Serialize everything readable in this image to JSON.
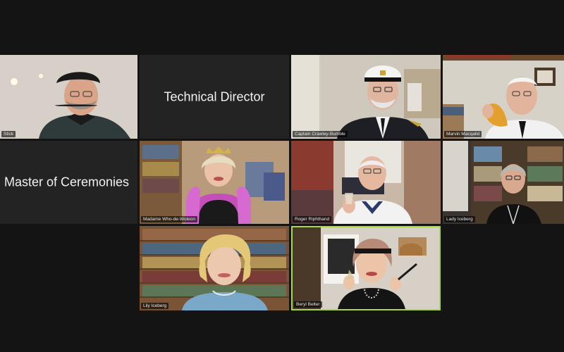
{
  "meeting": {
    "tiles": [
      {
        "name": "Stick"
      },
      {
        "title": "Technical Director"
      },
      {
        "name": "Captain Crawley-Bumble"
      },
      {
        "name": "Marvin Macqalid"
      },
      {
        "title": "Master of Ceremonies"
      },
      {
        "name": "Madame Who-de-Woleon"
      },
      {
        "name": "Roger Riphthand"
      },
      {
        "name": "Lady Iceberg"
      },
      {
        "name": "Lily Iceberg"
      },
      {
        "name": "Beryl Belter"
      }
    ]
  },
  "colors": {
    "background": "#141414",
    "tile_text_background": "#232323",
    "active_speaker_border": "#a8d84a"
  }
}
